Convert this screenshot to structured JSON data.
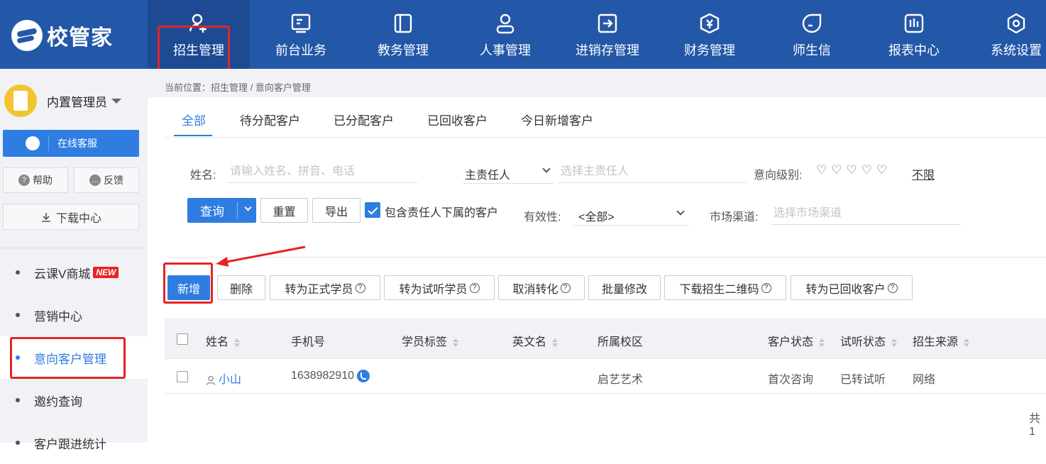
{
  "app": {
    "logo_text": "校管家"
  },
  "nav": {
    "items": [
      {
        "label": "招生管理",
        "icon": "user-add-icon"
      },
      {
        "label": "前台业务",
        "icon": "monitor-icon"
      },
      {
        "label": "教务管理",
        "icon": "book-icon"
      },
      {
        "label": "人事管理",
        "icon": "person-icon"
      },
      {
        "label": "进销存管理",
        "icon": "inventory-icon"
      },
      {
        "label": "财务管理",
        "icon": "finance-icon"
      },
      {
        "label": "师生信",
        "icon": "chat-icon"
      },
      {
        "label": "报表中心",
        "icon": "report-icon"
      },
      {
        "label": "系统设置",
        "icon": "settings-icon"
      }
    ]
  },
  "sidebar": {
    "user_name": "内置管理员",
    "service_label": "在线客服",
    "help_label": "帮助",
    "feedback_label": "反馈",
    "download_label": "下载中心",
    "menu": [
      {
        "label": "云课V商城",
        "badge": "NEW"
      },
      {
        "label": "营销中心"
      },
      {
        "label": "意向客户管理"
      },
      {
        "label": "邀约查询"
      },
      {
        "label": "客户跟进统计"
      }
    ]
  },
  "breadcrumb": "当前位置：招生管理 / 意向客户管理",
  "tabs": [
    "全部",
    "待分配客户",
    "已分配客户",
    "已回收客户",
    "今日新增客户"
  ],
  "filters": {
    "name_label": "姓名:",
    "name_placeholder": "请输入姓名、拼音、电话",
    "owner_select": "主责任人",
    "owner_placeholder": "选择主责任人",
    "level_label": "意向级别:",
    "level_hearts": "♡♡♡♡♡",
    "level_unlimited": "不限",
    "validity_label": "有效性:",
    "validity_value": "<全部>",
    "channel_label": "市场渠道:",
    "channel_placeholder": "选择市场渠道"
  },
  "buttons": {
    "query": "查询",
    "reset": "重置",
    "export": "导出",
    "include_sub": "包含责任人下属的客户",
    "include_sub_checked": true
  },
  "actions": {
    "add": "新增",
    "delete": "删除",
    "to_formal": "转为正式学员",
    "to_trial": "转为试听学员",
    "cancel_conversion": "取消转化",
    "batch_edit": "批量修改",
    "download_qr": "下载招生二维码",
    "to_recycled": "转为已回收客户"
  },
  "table": {
    "headers": {
      "name": "姓名",
      "phone": "手机号",
      "tags": "学员标签",
      "english_name": "英文名",
      "campus": "所属校区",
      "customer_status": "客户状态",
      "trial_status": "试听状态",
      "source": "招生来源"
    },
    "rows": [
      {
        "name": "小山",
        "phone": "1638982910",
        "tags": "",
        "english_name": "",
        "campus": "启艺艺术",
        "customer_status": "首次咨询",
        "trial_status": "已转试听",
        "source": "网络"
      }
    ]
  },
  "footer": {
    "total_text": "共1"
  },
  "colors": {
    "nav_bg": "#2357a8",
    "primary": "#2f7de1",
    "highlight_box": "#e52424"
  }
}
